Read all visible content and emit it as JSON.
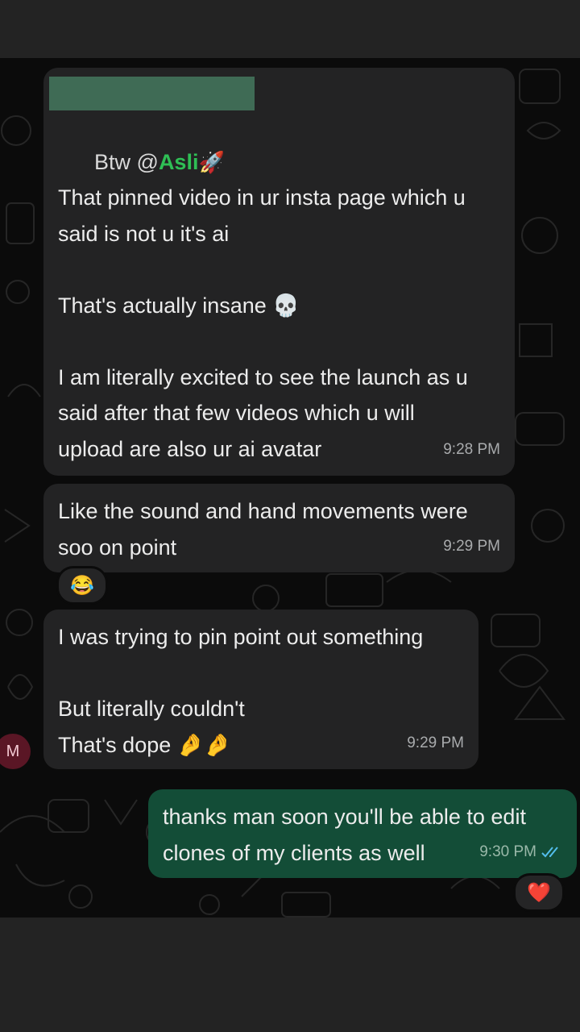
{
  "messages": [
    {
      "sender_redacted": true,
      "mention_prefix": "Btw @",
      "mention_name": "Asli",
      "mention_emoji": "🚀",
      "lines": [
        "",
        "That pinned video in ur insta page which u",
        "said is not u it's ai",
        "",
        "That's actually insane 💀",
        "",
        "I am literally excited to see the launch as u",
        "said after that few videos which u will",
        "upload are also ur ai avatar"
      ],
      "time": "9:28 PM"
    },
    {
      "lines": [
        "Like the sound and hand movements were",
        "soo on point"
      ],
      "time": "9:29 PM",
      "reaction": "😂"
    },
    {
      "lines": [
        "I was trying to pin point out something",
        "",
        "But literally couldn't",
        "That's dope 🤌🤌"
      ],
      "time": "9:29 PM"
    },
    {
      "lines": [
        "thanks man soon you'll be able to edit",
        "clones of my clients as well"
      ],
      "time": "9:30 PM",
      "read_icon": "double-check-icon",
      "reaction": "❤️"
    }
  ],
  "sender_avatar_letter": "M",
  "colors": {
    "incoming_bubble": "#232324",
    "outgoing_bubble": "#134d37",
    "mention": "#2fbf55",
    "read_ticks": "#53bdeb"
  }
}
